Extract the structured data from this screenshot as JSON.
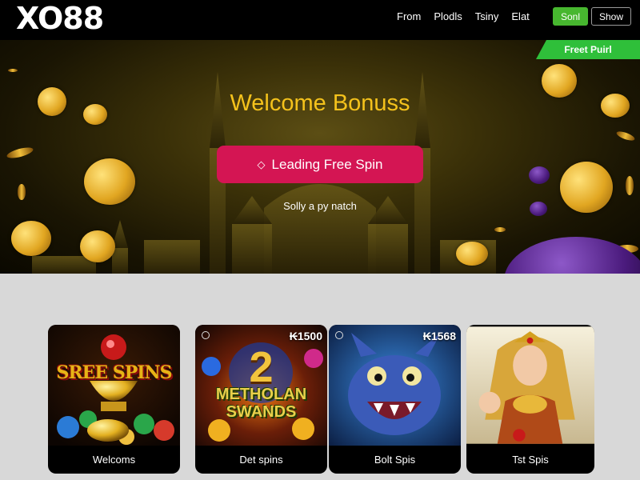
{
  "header": {
    "logo": "XO88",
    "nav": [
      "From",
      "Plodls",
      "Tsiny",
      "Elat"
    ],
    "signin_label": "Sonl",
    "show_label": "Show"
  },
  "hero": {
    "ribbon": "Freet Puirl",
    "title": "Welcome Bonuss",
    "cta_label": "Leading Free Spin",
    "cta_icon": "diamond-icon",
    "subtitle": "Solly a py natch"
  },
  "games": [
    {
      "label": "Welcoms",
      "art_text": "SREE SPINS",
      "amount": ""
    },
    {
      "label": "Det spins",
      "art_number": "2",
      "art_text": "METHOLAN SWANDS",
      "amount": "₭1500"
    },
    {
      "label": "Bolt Spis",
      "amount": "₭1568"
    },
    {
      "label": "Tst Spis",
      "amount": ""
    }
  ],
  "colors": {
    "header_bg": "#000000",
    "accent_green": "#47b72f",
    "cta_pink": "#d41553",
    "title_gold": "#f4c21c",
    "games_bg": "#d8d8d8"
  }
}
